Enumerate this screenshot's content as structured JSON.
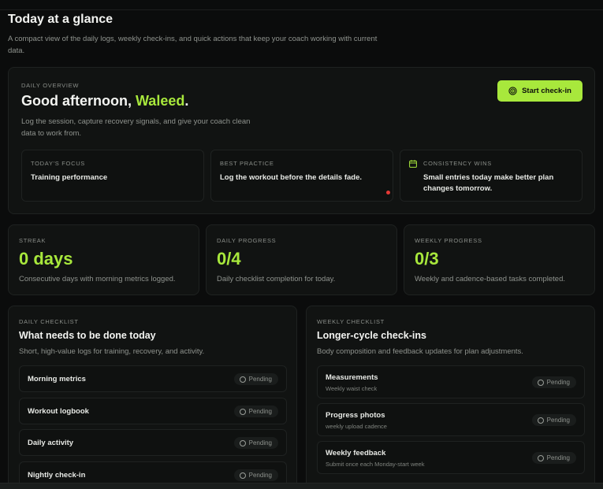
{
  "header": {
    "title": "Today at a glance",
    "subtitle": "A compact view of the daily logs, weekly check-ins, and quick actions that keep your coach working with current data."
  },
  "overview": {
    "eyebrow": "DAILY OVERVIEW",
    "greeting_prefix": "Good afternoon, ",
    "name": "Waleed",
    "greeting_suffix": ".",
    "description": "Log the session, capture recovery signals, and give your coach clean data to work from.",
    "checkin_label": "Start check-in",
    "tips": [
      {
        "eyebrow": "TODAY'S FOCUS",
        "text": "Training performance"
      },
      {
        "eyebrow": "BEST PRACTICE",
        "text": "Log the workout before the details fade."
      },
      {
        "eyebrow": "CONSISTENCY WINS",
        "text": "Small entries today make better plan changes tomorrow."
      }
    ]
  },
  "stats": [
    {
      "eyebrow": "STREAK",
      "value": "0 days",
      "desc": "Consecutive days with morning metrics logged."
    },
    {
      "eyebrow": "DAILY PROGRESS",
      "value": "0/4",
      "desc": "Daily checklist completion for today."
    },
    {
      "eyebrow": "WEEKLY PROGRESS",
      "value": "0/3",
      "desc": "Weekly and cadence-based tasks completed."
    }
  ],
  "daily": {
    "eyebrow": "DAILY CHECKLIST",
    "title": "What needs to be done today",
    "desc": "Short, high-value logs for training, recovery, and activity.",
    "items": [
      {
        "label": "Morning metrics",
        "status": "Pending"
      },
      {
        "label": "Workout logbook",
        "status": "Pending"
      },
      {
        "label": "Daily activity",
        "status": "Pending"
      },
      {
        "label": "Nightly check-in",
        "status": "Pending"
      }
    ]
  },
  "weekly": {
    "eyebrow": "WEEKLY CHECKLIST",
    "title": "Longer-cycle check-ins",
    "desc": "Body composition and feedback updates for plan adjustments.",
    "items": [
      {
        "label": "Measurements",
        "sub": "Weekly waist check",
        "status": "Pending"
      },
      {
        "label": "Progress photos",
        "sub": "weekly upload cadence",
        "status": "Pending"
      },
      {
        "label": "Weekly feedback",
        "sub": "Submit once each Monday-start week",
        "status": "Pending"
      }
    ]
  },
  "colors": {
    "accent": "#a8e83c",
    "background": "#0b0c0c",
    "card": "#111312",
    "alert_dot": "#e53935"
  }
}
